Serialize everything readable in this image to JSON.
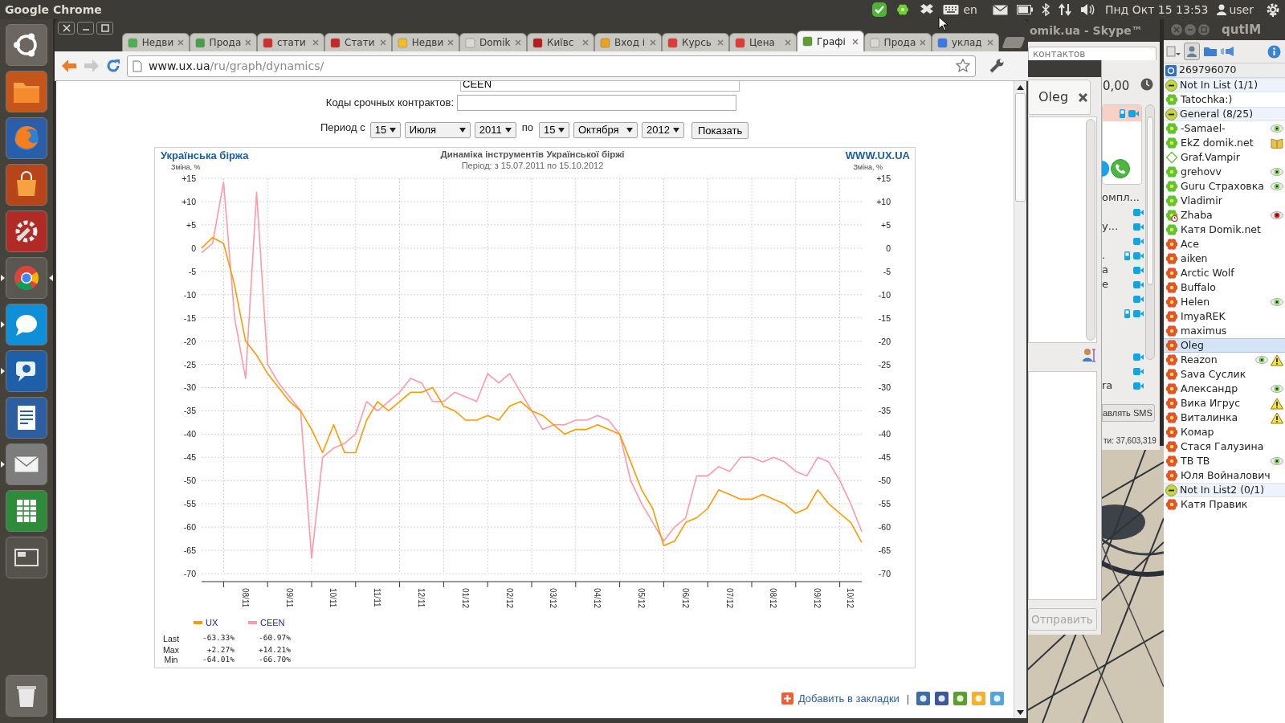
{
  "top_panel": {
    "app_name": "Google Chrome",
    "keyboard_layout": "en",
    "clock": "Пнд Окт 15 13:53",
    "user": "user"
  },
  "launcher": {
    "items": [
      {
        "kind": "home",
        "running": false,
        "focused": false
      },
      {
        "kind": "files",
        "running": false,
        "focused": false
      },
      {
        "kind": "browser",
        "running": false,
        "focused": false
      },
      {
        "kind": "store",
        "running": false,
        "focused": false
      },
      {
        "kind": "settings",
        "running": false,
        "focused": false
      },
      {
        "kind": "chrome",
        "running": true,
        "focused": true
      },
      {
        "kind": "skype",
        "running": true,
        "focused": false
      },
      {
        "kind": "qutim",
        "running": true,
        "focused": false
      },
      {
        "kind": "writer",
        "running": false,
        "focused": false
      },
      {
        "kind": "mail",
        "running": true,
        "focused": false
      },
      {
        "kind": "calc",
        "running": false,
        "focused": false
      },
      {
        "kind": "workspaces",
        "running": false,
        "focused": false
      },
      {
        "kind": "trash",
        "running": false,
        "focused": false
      }
    ]
  },
  "browser": {
    "tabs": [
      {
        "title": "Недви",
        "color": "#4caf50",
        "selected": false
      },
      {
        "title": "Прода",
        "color": "#43a047",
        "selected": false
      },
      {
        "title": "стати",
        "color": "#d32f2f",
        "selected": false
      },
      {
        "title": "Стати",
        "color": "#c62828",
        "selected": false
      },
      {
        "title": "Недви",
        "color": "#f2c01e",
        "selected": false
      },
      {
        "title": "Domik",
        "color": "#d9d9d9",
        "selected": false
      },
      {
        "title": "Київс",
        "color": "#b71c1c",
        "selected": false
      },
      {
        "title": "Вход і",
        "color": "#e8a21c",
        "selected": false
      },
      {
        "title": "Курсь",
        "color": "#e53935",
        "selected": false
      },
      {
        "title": "Цена",
        "color": "#e53935",
        "selected": false
      },
      {
        "title": "Графі",
        "color": "#5aa02c",
        "selected": true
      },
      {
        "title": "Прода",
        "color": "#d9d9d9",
        "selected": false
      },
      {
        "title": "уклад",
        "color": "#3b78e7",
        "selected": false
      }
    ],
    "address": {
      "host": "www.ux.ua",
      "path": "/ru/graph/dynamics/"
    }
  },
  "page": {
    "instrument_field": {
      "value": "CEEN"
    },
    "contracts": {
      "label": "Коды срочных контрактов:"
    },
    "period": {
      "label_from": "Период с",
      "from": [
        "15",
        "Июля",
        "2011"
      ],
      "label_to": "по",
      "to": [
        "15",
        "Октября",
        "2012"
      ],
      "button": "Показать"
    },
    "chart": {
      "brand": "Українська біржа",
      "subtitle": "Період: з 15.07.2011 по 15.10.2012",
      "site": "WWW.UX.UA",
      "right_axis": {
        "label": "Зміна, %",
        "ticks": [
          "+15",
          "+10",
          "+5",
          "0",
          "-5",
          "-10",
          "-15",
          "-20",
          "-25",
          "-30",
          "-35",
          "-40",
          "-45",
          "-50",
          "-55",
          "-60",
          "-65",
          "-70"
        ]
      },
      "chart_data": {
        "type": "line",
        "title": "Динаміка інструментів Української біржі",
        "ylabel": "Зміна, %",
        "grid": true,
        "legend": true,
        "categories": [
          null,
          null,
          null,
          null,
          "08/11",
          null,
          null,
          null,
          "09/11",
          null,
          null,
          null,
          "10/11",
          null,
          null,
          null,
          "11/11",
          null,
          null,
          null,
          "12/11",
          null,
          null,
          null,
          "01/12",
          null,
          null,
          null,
          "02/12",
          null,
          null,
          null,
          "03/12",
          null,
          null,
          null,
          "04/12",
          null,
          null,
          null,
          "05/12",
          null,
          null,
          null,
          "06/12",
          null,
          null,
          null,
          "07/12",
          null,
          null,
          null,
          "08/12",
          null,
          null,
          null,
          "09/12",
          null,
          null,
          "10/12",
          null
        ],
        "ylim": [
          -70,
          15
        ],
        "yticks": [
          {
            "value": 15,
            "label": "+15"
          },
          {
            "value": 10,
            "label": "+10"
          },
          {
            "value": 5,
            "label": "+5"
          },
          {
            "value": 0,
            "label": "0"
          },
          {
            "value": -5,
            "label": "-5"
          },
          {
            "value": -10,
            "label": "-10"
          },
          {
            "value": -15,
            "label": "-15"
          },
          {
            "value": -20,
            "label": "-20"
          },
          {
            "value": -25,
            "label": "-25"
          },
          {
            "value": -30,
            "label": "-30"
          },
          {
            "value": -35,
            "label": "-35"
          },
          {
            "value": -40,
            "label": "-40"
          },
          {
            "value": -45,
            "label": "-45"
          },
          {
            "value": -50,
            "label": "-50"
          },
          {
            "value": -55,
            "label": "-55"
          },
          {
            "value": -60,
            "label": "-60"
          },
          {
            "value": -65,
            "label": "-65"
          },
          {
            "value": -70,
            "label": "-70"
          }
        ],
        "series": [
          {
            "name": "UX",
            "color": "#ff9900",
            "values": [
              0,
              2.27,
              1,
              -8,
              -20,
              -23,
              -27,
              -30,
              -33,
              -35,
              -39,
              -44,
              -38,
              -44,
              -44,
              -37,
              -33,
              -35,
              -33,
              -31,
              -31,
              -30,
              -34,
              -35,
              -37,
              -37,
              -36,
              -37,
              -34,
              -33,
              -35,
              -36,
              -38,
              -40,
              -39,
              -39,
              -38,
              -39,
              -40,
              -46,
              -52,
              -56,
              -64.01,
              -63,
              -59,
              -58,
              -56,
              -52,
              -53,
              -54,
              -54,
              -53,
              -54,
              -55,
              -57,
              -56,
              -52,
              -55,
              -57,
              -59,
              -63.33
            ]
          },
          {
            "name": "CEEN",
            "color": "#ff99aa",
            "values": [
              -1,
              1,
              14.21,
              -15,
              -28,
              12,
              -25,
              -29,
              -32,
              -35,
              -66.7,
              -45,
              -43,
              -42,
              -40,
              -33,
              -35,
              -33,
              -31,
              -28,
              -29,
              -33,
              -33,
              -31,
              -32,
              -33,
              -27,
              -29,
              -27,
              -31,
              -35,
              -39,
              -38,
              -38,
              -37,
              -37,
              -36,
              -37,
              -40,
              -50,
              -55,
              -59,
              -63,
              -60,
              -58,
              -49,
              -49,
              -47,
              -48,
              -45,
              -45,
              -46,
              -45,
              -46,
              -48,
              -49,
              -45,
              -46,
              -50,
              -55,
              -60.97
            ]
          }
        ]
      },
      "stats": [
        {
          "label": "Last",
          "values": [
            "-63.33%",
            "-60.97%"
          ]
        },
        {
          "label": "Max",
          "values": [
            "+2.27%",
            "+14.21%"
          ]
        },
        {
          "label": "Min",
          "values": [
            "-64.01%",
            "-66.70%"
          ]
        }
      ]
    },
    "footer": {
      "bookmark": "Добавить в закладки",
      "separator": "|"
    }
  },
  "skype": {
    "title": "omik.ua - Skype™",
    "search_placeholder": "контактов",
    "balance": "0,00",
    "list": [
      {
        "text": "омпл...",
        "video": false,
        "mobile": false
      },
      {
        "video": true,
        "mobile": false
      },
      {
        "text": "у...",
        "video": true,
        "mobile": false
      },
      {
        "video": true,
        "mobile": false
      },
      {
        "text": ".",
        "video": true,
        "mobile": true
      },
      {
        "text": "a",
        "video": true,
        "mobile": false
      },
      {
        "text": "e",
        "video": true,
        "mobile": false
      },
      {
        "video": true,
        "mobile": false
      },
      {
        "video": true,
        "mobile": true
      },
      {
        "video": false,
        "mobile": false
      },
      {
        "video": false,
        "mobile": false
      },
      {
        "video": true,
        "mobile": false
      },
      {
        "video": true,
        "mobile": false
      },
      {
        "text": "ra",
        "video": true,
        "mobile": false
      }
    ],
    "sms_button": "авлять SMS",
    "online_count": "ти: 37,603,319"
  },
  "chat": {
    "tab": "Oleg",
    "send_button": "Отправить",
    "send_disabled": true
  },
  "qutim": {
    "title": "qutIM",
    "account": "269796070",
    "groups": [
      {
        "name": "Not In List (1/1)",
        "expanded": true,
        "children": [
          {
            "name": "Tatochka:)",
            "kind": "online",
            "selected": false
          }
        ]
      },
      {
        "name": "General (8/25)",
        "expanded": true,
        "children": [
          {
            "name": "-Samael-",
            "kind": "online",
            "visible": true,
            "selected": false
          },
          {
            "name": "EkZ domik.net",
            "kind": "online",
            "note": true,
            "selected": false
          },
          {
            "name": "Graf.Vampir",
            "kind": "invisible",
            "selected": false
          },
          {
            "name": "grehovv",
            "kind": "online",
            "visible": true,
            "selected": false
          },
          {
            "name": "Guru Страховка",
            "kind": "online",
            "visible": true,
            "selected": false
          },
          {
            "name": "Vladimir",
            "kind": "online",
            "selected": false
          },
          {
            "name": "Zhaba",
            "kind": "away",
            "ignored": true,
            "selected": false
          },
          {
            "name": "Катя Domik.net",
            "kind": "online",
            "selected": false
          },
          {
            "name": "Ace",
            "kind": "offline",
            "selected": false
          },
          {
            "name": "aiken",
            "kind": "offline",
            "selected": false
          },
          {
            "name": "Arctic Wolf",
            "kind": "offline",
            "selected": false
          },
          {
            "name": "Buffalo",
            "kind": "offline",
            "selected": false
          },
          {
            "name": "Helen",
            "kind": "offline",
            "visible": true,
            "selected": false
          },
          {
            "name": "ImyaREK",
            "kind": "offline",
            "selected": false
          },
          {
            "name": "maximus",
            "kind": "offline",
            "selected": false
          },
          {
            "name": "Oleg",
            "kind": "offline",
            "selected": true
          },
          {
            "name": "Reazon",
            "kind": "offline",
            "visible": true,
            "alert": true,
            "selected": false
          },
          {
            "name": "Sava Суслик",
            "kind": "offline",
            "selected": false
          },
          {
            "name": "Александр",
            "kind": "offline",
            "visible": true,
            "selected": false
          },
          {
            "name": "Вика Игрус",
            "kind": "offline",
            "alert": true,
            "selected": false
          },
          {
            "name": "Виталинка",
            "kind": "offline",
            "alert": true,
            "selected": false
          },
          {
            "name": "Комар",
            "kind": "offline",
            "selected": false
          },
          {
            "name": "Стася Галузина",
            "kind": "offline",
            "selected": false
          },
          {
            "name": "ТВ ТВ",
            "kind": "offline",
            "visible": true,
            "selected": false
          },
          {
            "name": "Юля Войналович",
            "kind": "offline",
            "selected": false
          }
        ]
      },
      {
        "name": "Not In List2 (0/1)",
        "expanded": true,
        "children": [
          {
            "name": "Катя Правик",
            "kind": "offline",
            "selected": false
          }
        ]
      }
    ]
  }
}
